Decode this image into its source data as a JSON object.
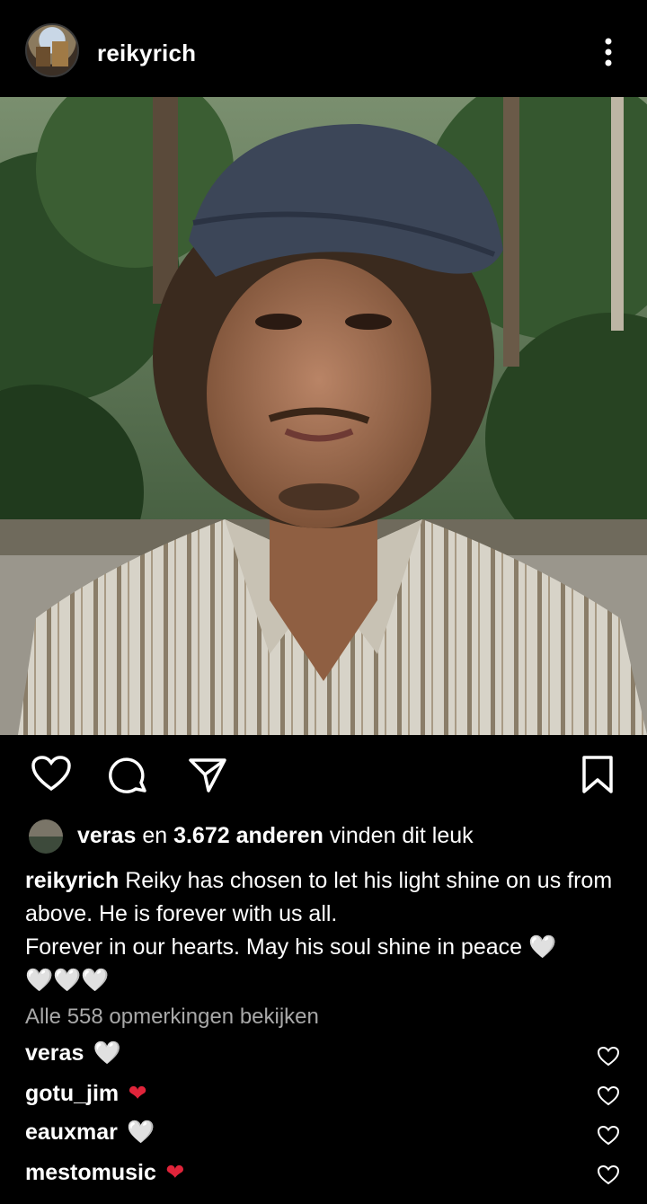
{
  "post": {
    "username": "reikyrich",
    "likes": {
      "first_user": "veras",
      "connector": "en",
      "others": "3.672 anderen",
      "suffix": "vinden dit leuk"
    },
    "caption": {
      "user": "reikyrich",
      "line1": "Reiky has chosen to let his light shine on us from above. He is forever with us all.",
      "line2": "Forever in our hearts. May his soul shine in peace",
      "emoji_white": "🤍",
      "emoji_row": "🤍🤍🤍"
    },
    "view_all_comments": "Alle 558 opmerkingen bekijken",
    "comments": [
      {
        "user": "veras",
        "emoji": "🤍",
        "emoji_color": "white"
      },
      {
        "user": "gotu_jim",
        "emoji": "❤",
        "emoji_color": "red"
      },
      {
        "user": "eauxmar",
        "emoji": "🤍",
        "emoji_color": "white"
      },
      {
        "user": "mestomusic",
        "emoji": "❤",
        "emoji_color": "red"
      }
    ]
  },
  "icons": {
    "more": "more-vertical-icon",
    "like": "heart-icon",
    "comment": "comment-icon",
    "share": "send-icon",
    "save": "bookmark-icon"
  },
  "colors": {
    "background": "#000000",
    "text": "#ffffff",
    "muted": "#a8a8a8",
    "heart_red": "#e0243a"
  }
}
